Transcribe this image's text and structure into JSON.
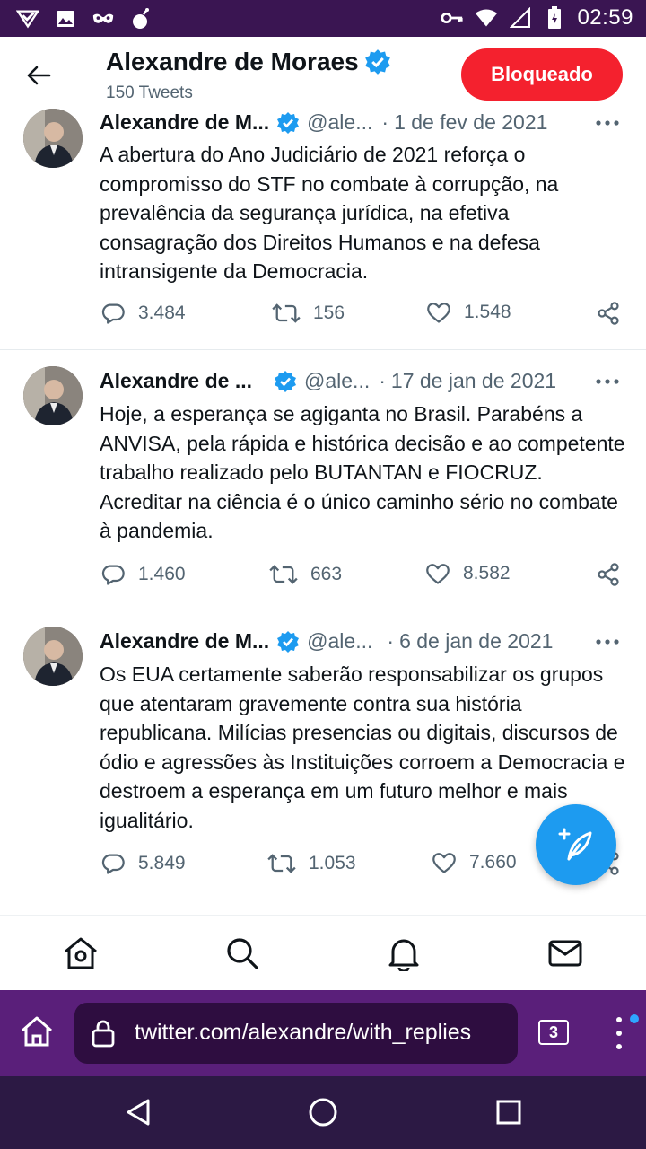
{
  "status_bar": {
    "time": "02:59",
    "left_icons": [
      "vpn-check-icon",
      "image-icon",
      "mask-icon",
      "bomb-icon"
    ],
    "right_icons": [
      "key-icon",
      "wifi-icon",
      "signal-icon",
      "battery-icon"
    ]
  },
  "header": {
    "title": "Alexandre de Moraes",
    "tweet_count": "150 Tweets",
    "blocked_label": "Bloqueado"
  },
  "tweets": [
    {
      "name": "Alexandre de M...",
      "handle": "@ale...",
      "separator": "·",
      "date": "1 de fev de 2021",
      "text": "A abertura do Ano Judiciário de 2021 reforça o compromisso do STF no combate à corrupção, na prevalência da segurança jurídica, na efetiva consagração dos Direitos Humanos e na defesa intransigente da Democracia.",
      "replies": "3.484",
      "retweets": "156",
      "likes": "1.548"
    },
    {
      "name": "Alexandre de ...",
      "handle": "@ale...",
      "separator": "·",
      "date": "17 de jan de 2021",
      "text": "Hoje, a esperança se agiganta no Brasil. Parabéns a ANVISA, pela rápida e histórica decisão e ao competente trabalho realizado pelo BUTANTAN e FIOCRUZ. Acreditar na ciência é o único caminho sério no combate à pandemia.",
      "replies": "1.460",
      "retweets": "663",
      "likes": "8.582"
    },
    {
      "name": "Alexandre de M...",
      "handle": "@ale...",
      "separator": "·",
      "date": "6 de jan de 2021",
      "text": "Os EUA certamente saberão responsabilizar os grupos que atentaram gravemente contra sua história republicana. Milícias presencias ou digitais, discursos de ódio e agressões às Instituições corroem a Democracia e destroem a esperança em um futuro melhor e mais igualitário.",
      "replies": "5.849",
      "retweets": "1.053",
      "likes": "7.660"
    }
  ],
  "bottom_nav": [
    "home-icon",
    "search-icon",
    "notifications-icon",
    "messages-icon"
  ],
  "browser": {
    "url": "twitter.com/alexandre/with_replies",
    "tab_count": "3"
  },
  "colors": {
    "accent": "#1d9bf0",
    "blocked": "#f4212e",
    "status_bar": "#3a1552",
    "browser_bar": "#5a1f7a",
    "system_nav": "#2c1944"
  }
}
